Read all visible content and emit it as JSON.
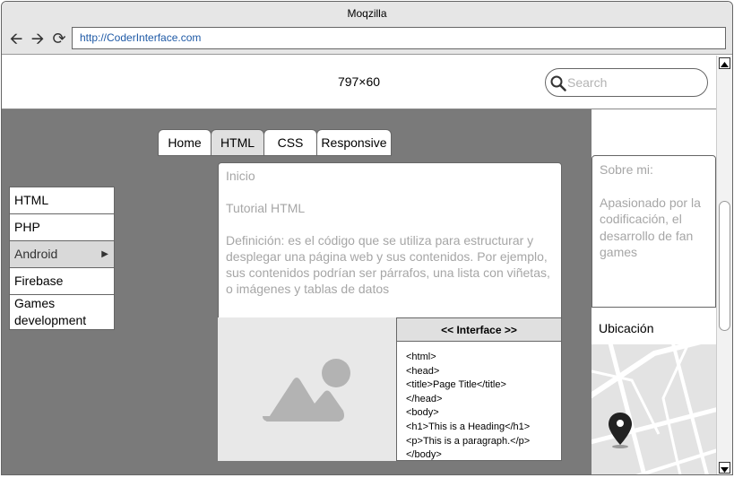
{
  "window": {
    "title": "Moqzilla"
  },
  "toolbar": {
    "url": "http://CoderInterface.com"
  },
  "header": {
    "size_label": "797×60",
    "search_placeholder": "Search"
  },
  "tabs": [
    {
      "label": "Home",
      "active": false
    },
    {
      "label": "HTML",
      "active": true
    },
    {
      "label": "CSS",
      "active": false
    },
    {
      "label": "Responsive",
      "active": false
    }
  ],
  "menu": [
    {
      "label": "HTML"
    },
    {
      "label": "PHP"
    },
    {
      "label": "Android",
      "selected": true,
      "submenu_icon": "triangle-right-icon"
    },
    {
      "label": "Firebase"
    },
    {
      "label": "Games development"
    }
  ],
  "article": {
    "title": "Inicio",
    "subtitle": "Tutorial HTML",
    "definition": "Definición:  es el código que se utiliza para estructurar y desplegar una página web y sus contenidos. Por ejemplo, sus contenidos podrían ser párrafos, una lista con viñetas, o imágenes y tablas de datos"
  },
  "code_panel": {
    "header": "<< Interface >>",
    "lines": [
      "<html>",
      "<head>",
      "<title>Page Title</title>",
      "</head>",
      "<body>",
      "<h1>This is a Heading</h1>",
      "<p>This is a paragraph.</p>",
      "</body>"
    ]
  },
  "sidebar": {
    "about_title": "Sobre mi:",
    "about_text": "Apasionado por la codificación, el desarrollo de fan games",
    "location_label": "Ubicación"
  },
  "icons": {
    "back": "arrow-left-icon",
    "forward": "arrow-right-icon",
    "reload": "reload-icon",
    "search": "search-icon",
    "image": "image-placeholder-icon",
    "map_pin": "map-pin-icon"
  },
  "colors": {
    "content_bg": "#7a7a7a",
    "url_text": "#1f5aa6",
    "placeholder_text": "#a6a6a6"
  }
}
